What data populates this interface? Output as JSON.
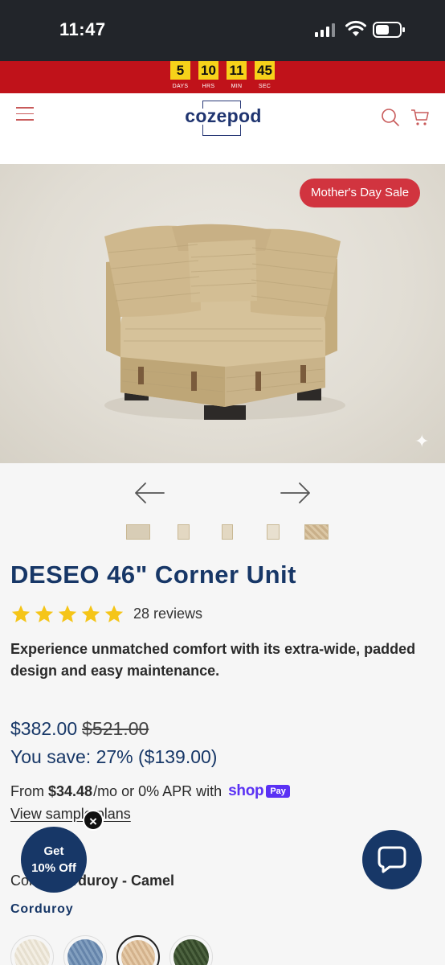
{
  "status_bar": {
    "time": "11:47"
  },
  "countdown": [
    {
      "value": "5",
      "label": "DAYS"
    },
    {
      "value": "10",
      "label": "HRS"
    },
    {
      "value": "11",
      "label": "MIN"
    },
    {
      "value": "45",
      "label": "SEC"
    }
  ],
  "header": {
    "logo_text": "cozepod"
  },
  "hero": {
    "badge": "Mother's Day Sale"
  },
  "product": {
    "title": "DESEO 46\" Corner Unit",
    "rating_stars": 5,
    "review_count": "28 reviews",
    "description": "Experience unmatched comfort with its extra-wide, padded design and easy maintenance.",
    "price": "$382.00",
    "compare_price": "$521.00",
    "savings": "You save: 27% ($139.00)",
    "installments": {
      "prefix": "From",
      "amount": "$34.48",
      "suffix": "/mo or 0% APR with",
      "provider": "shop",
      "provider_pill": "Pay",
      "link": "View sample plans"
    },
    "color_label": "Color:",
    "color_value": "Corduroy - Camel",
    "material": "Corduroy",
    "swatches": [
      {
        "name": "Ivory",
        "color": "#ece6d8"
      },
      {
        "name": "Blue",
        "color": "#6f8fb3"
      },
      {
        "name": "Camel",
        "color": "#d9b996",
        "selected": true
      },
      {
        "name": "Green",
        "color": "#3e5230"
      }
    ]
  },
  "promo": {
    "line1": "Get",
    "line2": "10% Off",
    "close": "×"
  },
  "colors": {
    "accent": "#173767",
    "sale_red": "#c0121a",
    "badge_red": "#d1343f",
    "countdown_yellow": "#f6d21a",
    "star": "#f5c518"
  }
}
